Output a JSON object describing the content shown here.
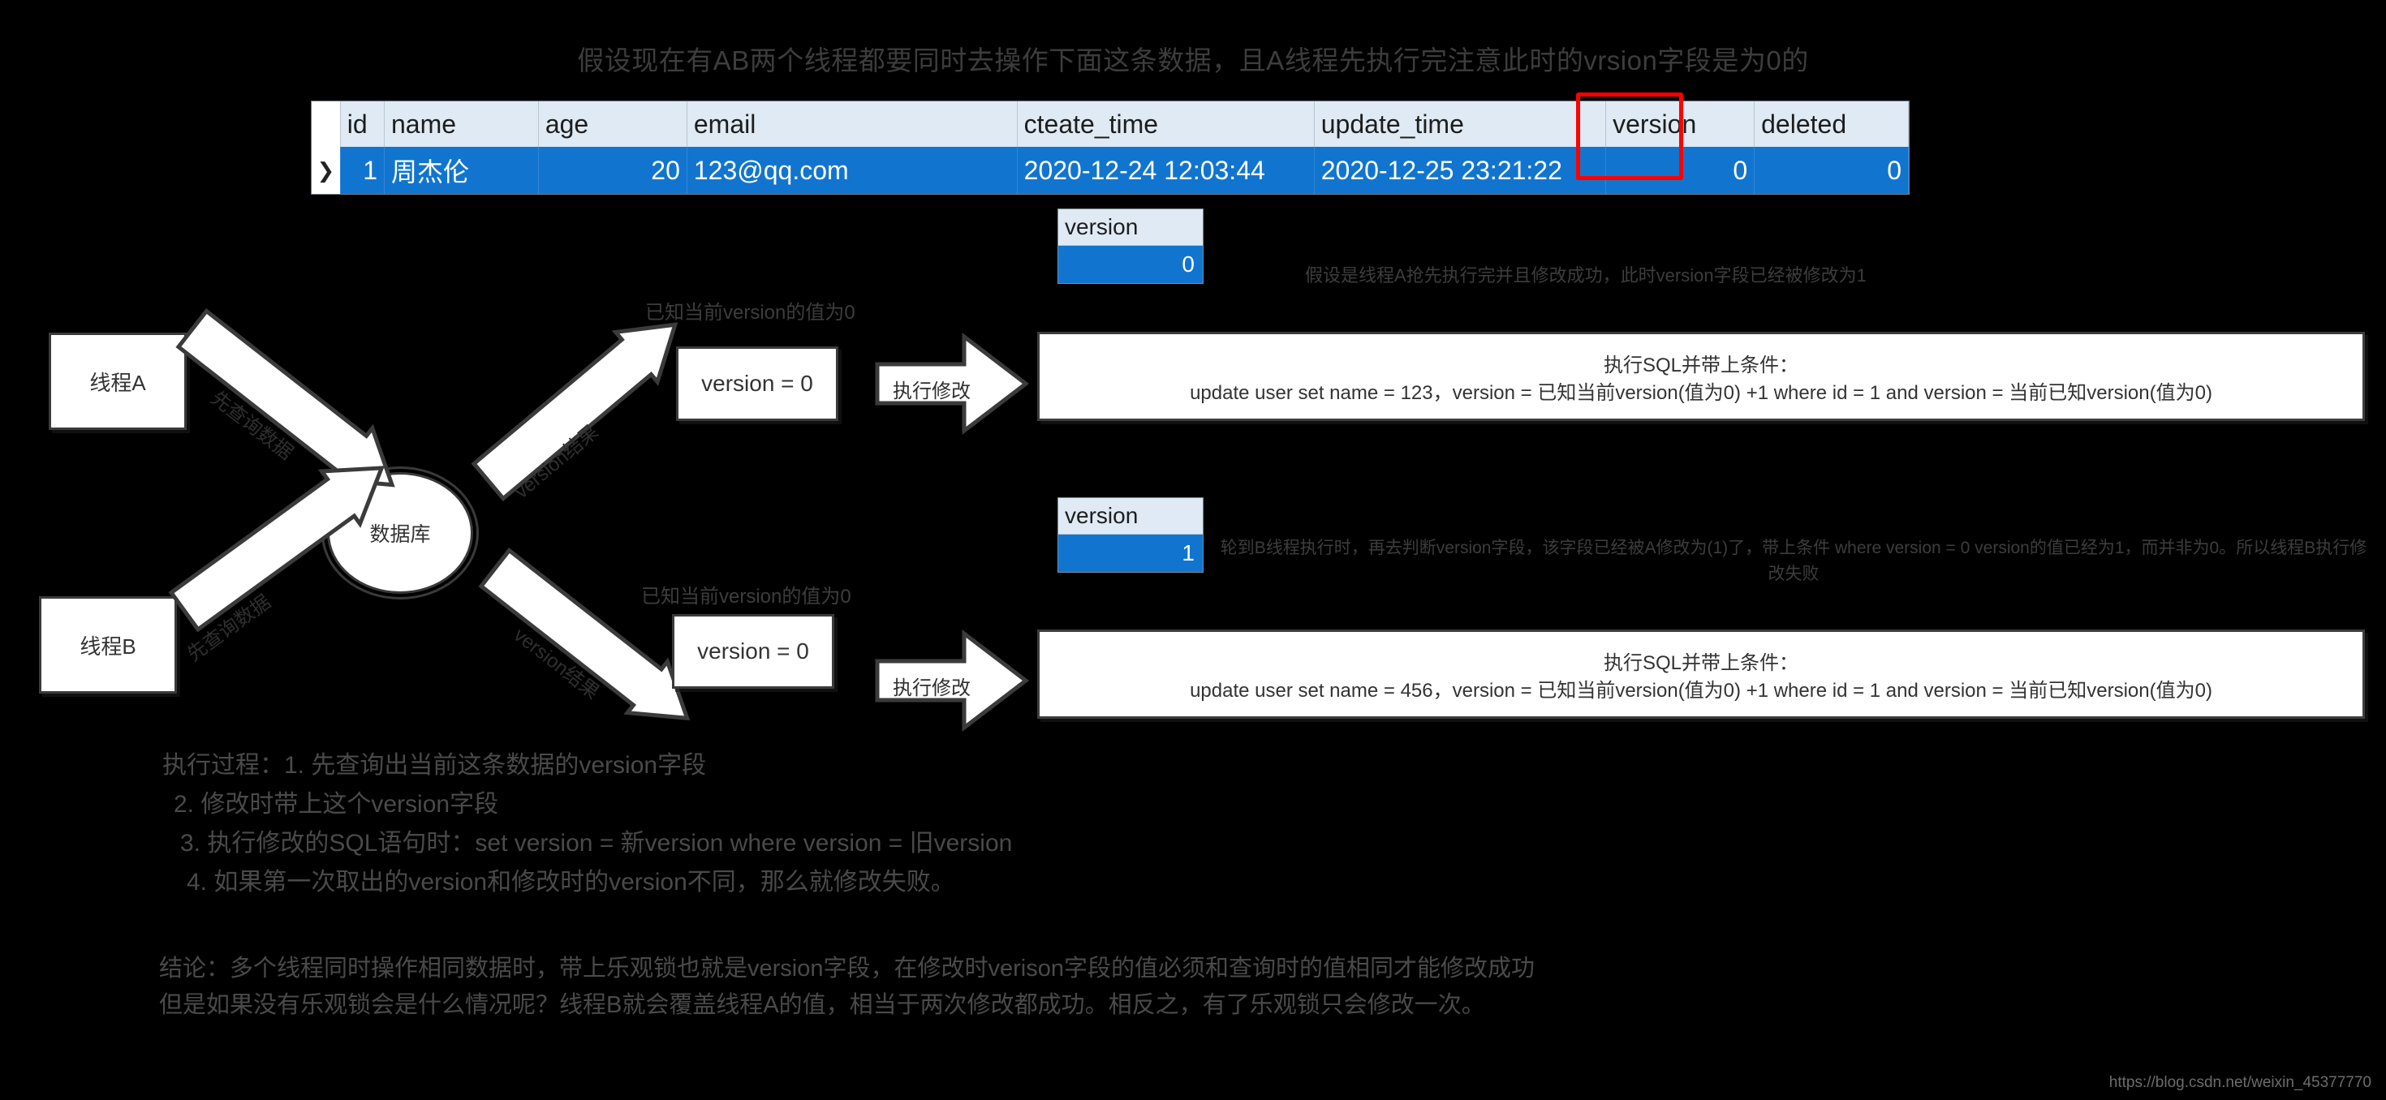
{
  "title": "假设现在有AB两个线程都要同时去操作下面这条数据，且A线程先执行完注意此时的vrsion字段是为0的",
  "colors": {
    "row_selected": "#1175cf",
    "header_bg": "#dfeaf5",
    "highlight_border": "#ff0000",
    "text": "#3d3d3d",
    "background": "#000000"
  },
  "db_table": {
    "row_marker": "❯",
    "columns": [
      "id",
      "name",
      "age",
      "email",
      "cteate_time",
      "update_time",
      "version",
      "deleted"
    ],
    "rows": [
      {
        "id": "1",
        "name": "周杰伦",
        "age": "20",
        "email": "123@qq.com",
        "cteate_time": "2020-12-24 12:03:44",
        "update_time": "2020-12-25 23:21:22",
        "version": "0",
        "deleted": "0"
      }
    ],
    "highlighted_column": "version"
  },
  "flow": {
    "thread_a": "线程A",
    "thread_b": "线程B",
    "database": "数据库",
    "arrow_query_a": "先查询数据",
    "arrow_query_b": "先查询数据",
    "arrow_result_a": "version结果",
    "arrow_result_b": "version结果",
    "arrow_execute_a": "执行修改",
    "arrow_execute_b": "执行修改",
    "version_value_a": "version = 0",
    "version_value_b": "version = 0",
    "note_known_a": "已知当前version的值为0",
    "note_known_b": "已知当前version的值为0"
  },
  "mini_tables": {
    "a": {
      "header": "version",
      "value": "0"
    },
    "b": {
      "header": "version",
      "value": "1"
    }
  },
  "notes": {
    "a_success": "假设是线程A抢先执行完并且修改成功，此时version字段已经被修改为1",
    "b_fail": "轮到B线程执行时，再去判断version字段，该字段已经被A修改为(1)了，带上条件 where version = 0 version的值已经为1，而并非为0。所以线程B执行修改失败"
  },
  "sql_boxes": {
    "a": {
      "line1": "执行SQL并带上条件：",
      "line2": "update user set name = 123，version = 已知当前version(值为0) +1 where id = 1 and version = 当前已知version(值为0)"
    },
    "b": {
      "line1": "执行SQL并带上条件：",
      "line2": "update user set name = 456，version = 已知当前version(值为0) +1 where id = 1 and version = 当前已知version(值为0)"
    }
  },
  "steps": {
    "line1": "执行过程：1. 先查询出当前这条数据的version字段",
    "line2": "2. 修改时带上这个version字段",
    "line3": "3. 执行修改的SQL语句时：set version = 新version where version = 旧version",
    "line4": "4. 如果第一次取出的version和修改时的version不同，那么就修改失败。"
  },
  "conclusion": {
    "line1": "结论：多个线程同时操作相同数据时，带上乐观锁也就是version字段，在修改时verison字段的值必须和查询时的值相同才能修改成功",
    "line2": "但是如果没有乐观锁会是什么情况呢？线程B就会覆盖线程A的值，相当于两次修改都成功。相反之，有了乐观锁只会修改一次。"
  },
  "watermark": "https://blog.csdn.net/weixin_45377770"
}
